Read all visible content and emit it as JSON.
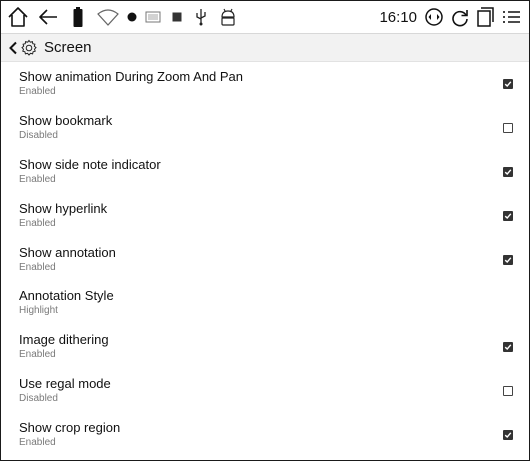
{
  "status_bar": {
    "time": "16:10",
    "icons": [
      "home-icon",
      "back-arrow-icon",
      "battery-icon",
      "wifi-off-icon",
      "dot-icon",
      "keyboard-icon",
      "stop-square-icon",
      "usb-icon",
      "android-icon",
      "rotate-screen-icon",
      "refresh-icon",
      "multitask-icon",
      "menu-list-icon"
    ]
  },
  "header": {
    "title": "Screen"
  },
  "settings": [
    {
      "label": "Show animation During Zoom And Pan",
      "status": "Enabled",
      "checkbox": true,
      "checked": true
    },
    {
      "label": "Show bookmark",
      "status": "Disabled",
      "checkbox": true,
      "checked": false
    },
    {
      "label": "Show side note indicator",
      "status": "Enabled",
      "checkbox": true,
      "checked": true
    },
    {
      "label": "Show hyperlink",
      "status": "Enabled",
      "checkbox": true,
      "checked": true
    },
    {
      "label": "Show annotation",
      "status": "Enabled",
      "checkbox": true,
      "checked": true
    },
    {
      "label": "Annotation Style",
      "status": "Highlight",
      "checkbox": false,
      "checked": false
    },
    {
      "label": "Image dithering",
      "status": "Enabled",
      "checkbox": true,
      "checked": true
    },
    {
      "label": "Use regal mode",
      "status": "Disabled",
      "checkbox": true,
      "checked": false
    },
    {
      "label": "Show crop region",
      "status": "Enabled",
      "checkbox": true,
      "checked": true
    }
  ]
}
